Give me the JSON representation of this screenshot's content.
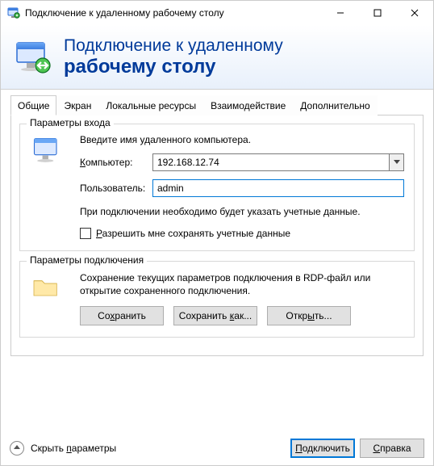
{
  "window": {
    "title": "Подключение к удаленному рабочему столу"
  },
  "banner": {
    "line1": "Подключение к удаленному",
    "line2": "рабочему столу"
  },
  "tabs": {
    "general": "Общие",
    "display": "Экран",
    "local": "Локальные ресурсы",
    "experience": "Взаимодействие",
    "advanced": "Дополнительно"
  },
  "login_group": {
    "title": "Параметры входа",
    "prompt": "Введите имя удаленного компьютера.",
    "computer_label": "Компьютер:",
    "computer_value": "192.168.12.74",
    "user_label": "Пользователь:",
    "user_value": "admin",
    "hint": "При подключении необходимо будет указать учетные данные.",
    "remember_label": "Разрешить мне сохранять учетные данные"
  },
  "connection_group": {
    "title": "Параметры подключения",
    "hint": "Сохранение текущих параметров подключения в RDP-файл или открытие сохраненного подключения.",
    "save": "Сохранить",
    "save_as": "Сохранить как...",
    "open": "Открыть..."
  },
  "footer": {
    "hide_params": "Скрыть параметры",
    "connect": "Подключить",
    "help": "Справка"
  }
}
